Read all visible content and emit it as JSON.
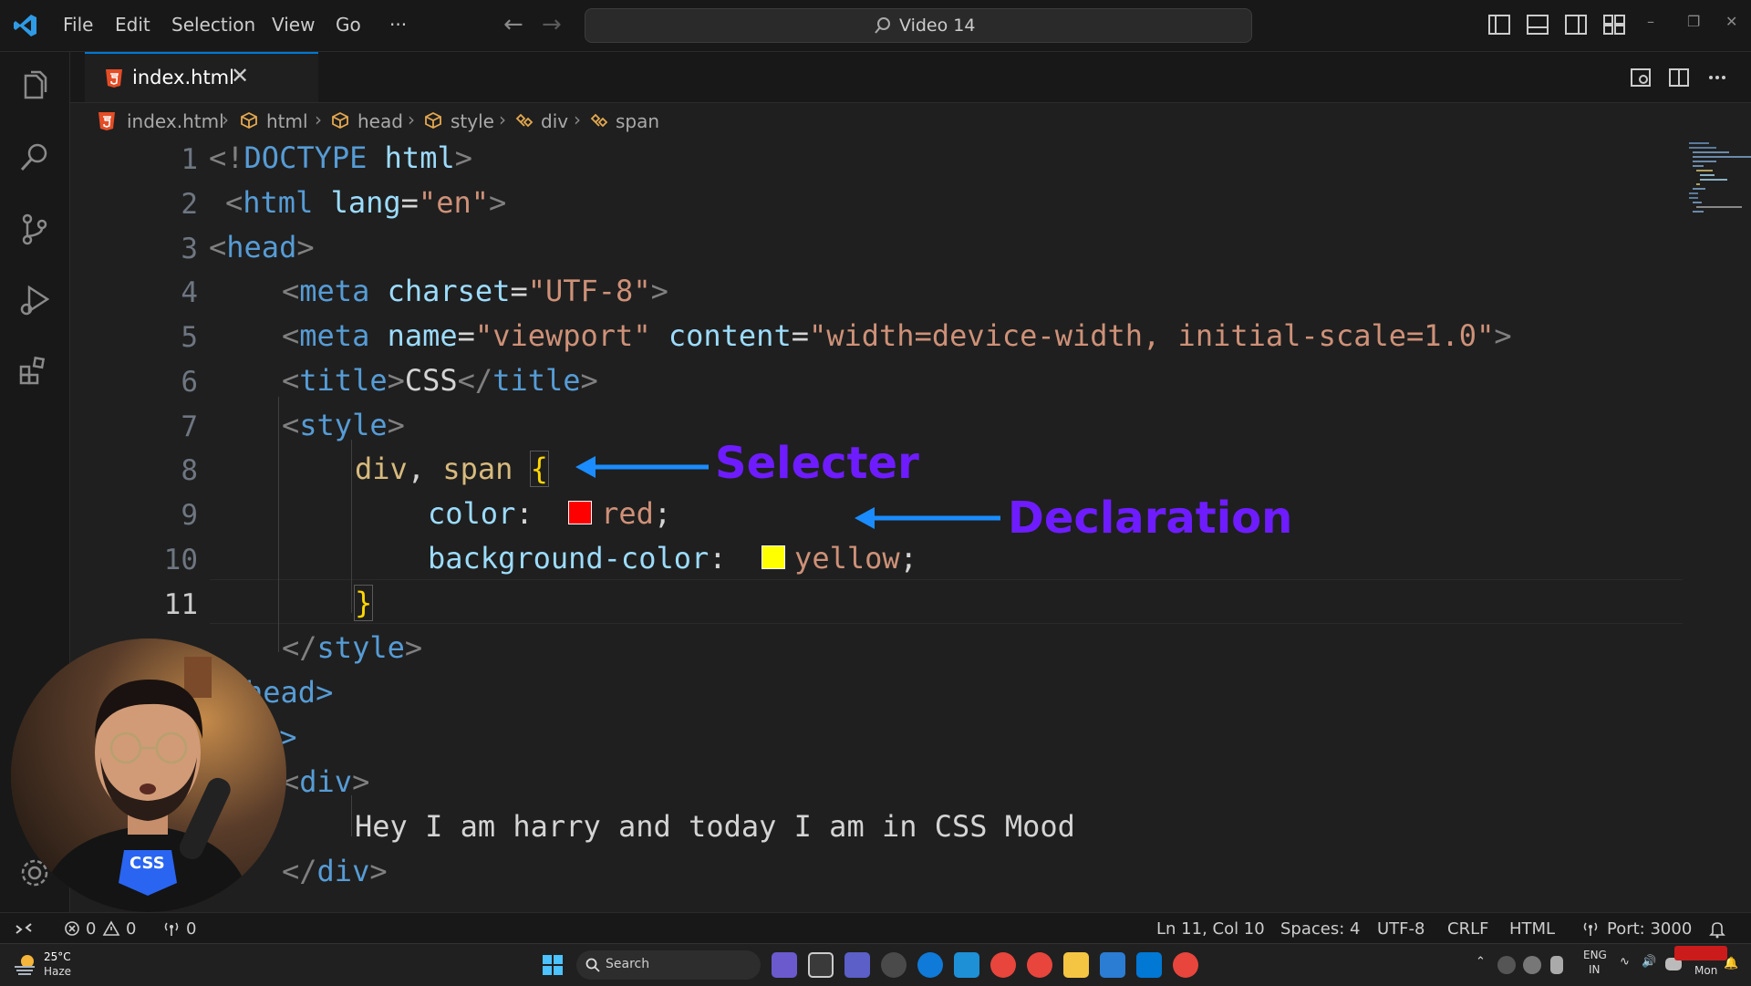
{
  "titlebar": {
    "menu": [
      "File",
      "Edit",
      "Selection",
      "View",
      "Go",
      "···"
    ],
    "back_arrow": "←",
    "forward_arrow": "→",
    "command_center": "Video 14",
    "window_controls": [
      "–",
      "❐",
      "✕"
    ]
  },
  "tab": {
    "filename": "index.html",
    "close_glyph": "✕"
  },
  "breadcrumb": [
    "index.html",
    "html",
    "head",
    "style",
    "div",
    "span"
  ],
  "editor": {
    "line_numbers": [
      "1",
      "2",
      "3",
      "4",
      "5",
      "6",
      "7",
      "8",
      "9",
      "10",
      "11"
    ],
    "active_line": "11",
    "lines": {
      "l1": {
        "open": "<!",
        "doctype": "DOCTYPE",
        "html": "html",
        "close": ">"
      },
      "l2": {
        "open": "<",
        "tag": "html",
        "attr": "lang",
        "eq": "=",
        "val": "\"en\"",
        "close": ">"
      },
      "l3": {
        "open": "<",
        "tag": "head",
        "close": ">"
      },
      "l4": {
        "open": "<",
        "tag": "meta",
        "attr": "charset",
        "eq": "=",
        "val": "\"UTF-8\"",
        "close": ">"
      },
      "l5": {
        "open": "<",
        "tag": "meta",
        "attr1": "name",
        "eq1": "=",
        "val1": "\"viewport\"",
        "attr2": "content",
        "eq2": "=",
        "val2": "\"width=device-width, initial-scale=1.0\"",
        "close": ">"
      },
      "l6": {
        "open": "<",
        "tag": "title",
        "close": ">",
        "text": "CSS",
        "open2": "</",
        "tag2": "title",
        "close2": ">"
      },
      "l7": {
        "open": "<",
        "tag": "style",
        "close": ">"
      },
      "l8": {
        "sel1": "div",
        "comma": ",",
        "sel2": "span",
        "brace": "{"
      },
      "l9": {
        "prop": "color",
        "colon": ":",
        "value": "red",
        "semi": ";"
      },
      "l10": {
        "prop": "background-color",
        "colon": ":",
        "value": "yellow",
        "semi": ";"
      },
      "l11": {
        "brace": "}"
      },
      "l12": {
        "open": "</",
        "tag": "style",
        "close": ">"
      },
      "l13": {
        "tail": "head>"
      },
      "l14": {
        "tail": "y>"
      },
      "l15": {
        "open": "<",
        "tag": "div",
        "close": ">"
      },
      "l16": {
        "text": "Hey I am harry and today I am in CSS Mood"
      },
      "l17": {
        "open": "</",
        "tag": "div",
        "close": ">"
      }
    },
    "swatches": {
      "red": "#ff0000",
      "yellow": "#ffff00"
    },
    "annotations": {
      "selector": "Selecter",
      "declaration": "Declaration",
      "color": "#6e1cff",
      "arrow_color": "#1a8cff"
    }
  },
  "statusbar": {
    "errors": "0",
    "warnings": "0",
    "ports_count": "0",
    "position": "Ln 11, Col 10",
    "spaces": "Spaces: 4",
    "encoding": "UTF-8",
    "eol": "CRLF",
    "language": "HTML",
    "port": "Port: 3000"
  },
  "taskbar": {
    "temperature": "25°C",
    "condition": "Haze",
    "search_label": "Search",
    "lang_1": "ENG",
    "lang_2": "IN",
    "day": "Mon"
  },
  "webcam": {
    "shirt_text": "CSS"
  }
}
